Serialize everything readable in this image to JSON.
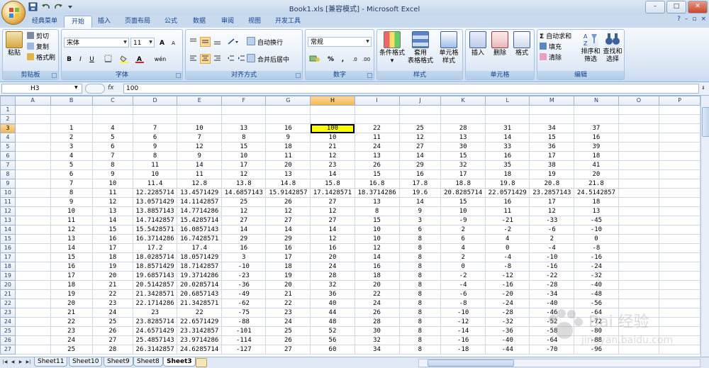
{
  "window": {
    "title": "Book1.xls [兼容模式] - Microsoft Excel",
    "controls": {
      "minimize": "–",
      "maximize": "□",
      "close": "✕"
    }
  },
  "tabs": [
    "经典菜单",
    "开始",
    "插入",
    "页面布局",
    "公式",
    "数据",
    "审阅",
    "视图",
    "开发工具"
  ],
  "active_tab": "开始",
  "ribbon": {
    "clipboard": {
      "label": "剪贴板",
      "paste": "粘贴",
      "cut": "剪切",
      "copy": "复制",
      "format_painter": "格式刷"
    },
    "font": {
      "label": "字体",
      "font_name": "宋体",
      "font_size": "11",
      "bold": "B",
      "italic": "I",
      "underline": "U",
      "grow": "A",
      "shrink": "A",
      "wen": "wén"
    },
    "alignment": {
      "label": "对齐方式",
      "wrap": "自动换行",
      "merge": "合并后居中"
    },
    "number": {
      "label": "数字",
      "format": "常规",
      "percent": "%",
      "comma": ","
    },
    "styles": {
      "label": "样式",
      "conditional": "条件格式",
      "table_line1": "套用",
      "table_line2": "表格格式",
      "cell_line1": "单元格",
      "cell_line2": "样式"
    },
    "cells": {
      "label": "单元格",
      "insert": "插入",
      "delete": "删除",
      "format": "格式"
    },
    "editing": {
      "label": "编辑",
      "autosum": "自动求和",
      "fill": "填充",
      "clear": "清除",
      "sort_line1": "排序和",
      "sort_line2": "筛选",
      "find_line1": "查找和",
      "find_line2": "选择"
    }
  },
  "formula_bar": {
    "name_box": "H3",
    "fx": "fx",
    "value": "100"
  },
  "columns": [
    "A",
    "B",
    "C",
    "D",
    "E",
    "F",
    "G",
    "H",
    "I",
    "J",
    "K",
    "L",
    "M",
    "N",
    "O",
    "P"
  ],
  "selected_column": "H",
  "selected_row": "3",
  "rows": [
    {
      "n": "1",
      "c": [
        "",
        "",
        "",
        "",
        "",
        "",
        "",
        "",
        "",
        "",
        "",
        "",
        "",
        "",
        "",
        ""
      ]
    },
    {
      "n": "2",
      "c": [
        "",
        "",
        "",
        "",
        "",
        "",
        "",
        "",
        "",
        "",
        "",
        "",
        "",
        "",
        "",
        ""
      ]
    },
    {
      "n": "3",
      "c": [
        "",
        "1",
        "4",
        "7",
        "10",
        "13",
        "16",
        "100",
        "22",
        "25",
        "28",
        "31",
        "34",
        "37",
        "",
        ""
      ]
    },
    {
      "n": "4",
      "c": [
        "",
        "2",
        "5",
        "6",
        "7",
        "8",
        "9",
        "10",
        "11",
        "12",
        "13",
        "14",
        "15",
        "16",
        "",
        ""
      ]
    },
    {
      "n": "5",
      "c": [
        "",
        "3",
        "6",
        "9",
        "12",
        "15",
        "18",
        "21",
        "24",
        "27",
        "30",
        "33",
        "36",
        "39",
        "",
        ""
      ]
    },
    {
      "n": "6",
      "c": [
        "",
        "4",
        "7",
        "8",
        "9",
        "10",
        "11",
        "12",
        "13",
        "14",
        "15",
        "16",
        "17",
        "18",
        "",
        ""
      ]
    },
    {
      "n": "7",
      "c": [
        "",
        "5",
        "8",
        "11",
        "14",
        "17",
        "20",
        "23",
        "26",
        "29",
        "32",
        "35",
        "38",
        "41",
        "",
        ""
      ]
    },
    {
      "n": "8",
      "c": [
        "",
        "6",
        "9",
        "10",
        "11",
        "12",
        "13",
        "14",
        "15",
        "16",
        "17",
        "18",
        "19",
        "20",
        "",
        ""
      ]
    },
    {
      "n": "9",
      "c": [
        "",
        "7",
        "10",
        "11.4",
        "12.8",
        "13.8",
        "14.8",
        "15.8",
        "16.8",
        "17.8",
        "18.8",
        "19.8",
        "20.8",
        "21.8",
        "",
        ""
      ]
    },
    {
      "n": "10",
      "c": [
        "",
        "8",
        "11",
        "12.2285714",
        "13.4571429",
        "14.6857143",
        "15.9142857",
        "17.1428571",
        "18.3714286",
        "19.6",
        "20.8285714",
        "22.0571429",
        "23.2857143",
        "24.5142857",
        "",
        ""
      ]
    },
    {
      "n": "11",
      "c": [
        "",
        "9",
        "12",
        "13.0571429",
        "14.1142857",
        "25",
        "26",
        "27",
        "13",
        "14",
        "15",
        "16",
        "17",
        "18",
        "",
        ""
      ]
    },
    {
      "n": "12",
      "c": [
        "",
        "10",
        "13",
        "13.8857143",
        "14.7714286",
        "12",
        "12",
        "12",
        "8",
        "9",
        "10",
        "11",
        "12",
        "13",
        "",
        ""
      ]
    },
    {
      "n": "13",
      "c": [
        "",
        "11",
        "14",
        "14.7142857",
        "15.4285714",
        "27",
        "27",
        "27",
        "15",
        "3",
        "-9",
        "-21",
        "-33",
        "-45",
        "",
        ""
      ]
    },
    {
      "n": "14",
      "c": [
        "",
        "12",
        "15",
        "15.5428571",
        "16.0857143",
        "14",
        "14",
        "14",
        "10",
        "6",
        "2",
        "-2",
        "-6",
        "-10",
        "",
        ""
      ]
    },
    {
      "n": "15",
      "c": [
        "",
        "13",
        "16",
        "16.3714286",
        "16.7428571",
        "29",
        "29",
        "12",
        "10",
        "8",
        "6",
        "4",
        "2",
        "0",
        "",
        ""
      ]
    },
    {
      "n": "16",
      "c": [
        "",
        "14",
        "17",
        "17.2",
        "17.4",
        "16",
        "16",
        "16",
        "12",
        "8",
        "4",
        "0",
        "-4",
        "-8",
        "",
        ""
      ]
    },
    {
      "n": "17",
      "c": [
        "",
        "15",
        "18",
        "18.0285714",
        "18.0571429",
        "3",
        "17",
        "20",
        "14",
        "8",
        "2",
        "-4",
        "-10",
        "-16",
        "",
        ""
      ]
    },
    {
      "n": "18",
      "c": [
        "",
        "16",
        "19",
        "18.8571429",
        "18.7142857",
        "-10",
        "18",
        "24",
        "16",
        "8",
        "0",
        "-8",
        "-16",
        "-24",
        "",
        ""
      ]
    },
    {
      "n": "19",
      "c": [
        "",
        "17",
        "20",
        "19.6857143",
        "19.3714286",
        "-23",
        "19",
        "28",
        "18",
        "8",
        "-2",
        "-12",
        "-22",
        "-32",
        "",
        ""
      ]
    },
    {
      "n": "20",
      "c": [
        "",
        "18",
        "21",
        "20.5142857",
        "20.0285714",
        "-36",
        "20",
        "32",
        "20",
        "8",
        "-4",
        "-16",
        "-28",
        "-40",
        "",
        ""
      ]
    },
    {
      "n": "21",
      "c": [
        "",
        "19",
        "22",
        "21.3428571",
        "20.6857143",
        "-49",
        "21",
        "36",
        "22",
        "8",
        "-6",
        "-20",
        "-34",
        "-48",
        "",
        ""
      ]
    },
    {
      "n": "22",
      "c": [
        "",
        "20",
        "23",
        "22.1714286",
        "21.3428571",
        "-62",
        "22",
        "40",
        "24",
        "8",
        "-8",
        "-24",
        "-40",
        "-56",
        "",
        ""
      ]
    },
    {
      "n": "23",
      "c": [
        "",
        "21",
        "24",
        "23",
        "22",
        "-75",
        "23",
        "44",
        "26",
        "8",
        "-10",
        "-28",
        "-46",
        "-64",
        "",
        ""
      ]
    },
    {
      "n": "24",
      "c": [
        "",
        "22",
        "25",
        "23.8285714",
        "22.6571429",
        "-88",
        "24",
        "48",
        "28",
        "8",
        "-12",
        "-32",
        "-52",
        "-72",
        "",
        ""
      ]
    },
    {
      "n": "25",
      "c": [
        "",
        "23",
        "26",
        "24.6571429",
        "23.3142857",
        "-101",
        "25",
        "52",
        "30",
        "8",
        "-14",
        "-36",
        "-58",
        "-80",
        "",
        ""
      ]
    },
    {
      "n": "26",
      "c": [
        "",
        "24",
        "27",
        "25.4857143",
        "23.9714286",
        "-114",
        "26",
        "56",
        "32",
        "8",
        "-16",
        "-40",
        "-64",
        "-88",
        "",
        ""
      ]
    },
    {
      "n": "27",
      "c": [
        "",
        "25",
        "28",
        "26.3142857",
        "24.6285714",
        "-127",
        "27",
        "60",
        "34",
        "8",
        "-18",
        "-44",
        "-70",
        "-96",
        "",
        ""
      ]
    }
  ],
  "sheet_tabs": [
    "Sheet11",
    "Sheet10",
    "Sheet9",
    "Sheet8",
    "Sheet3"
  ],
  "active_sheet": "Sheet3",
  "watermark": {
    "line1": "Bai 经验",
    "line2": "jingyan.baidu.com"
  }
}
